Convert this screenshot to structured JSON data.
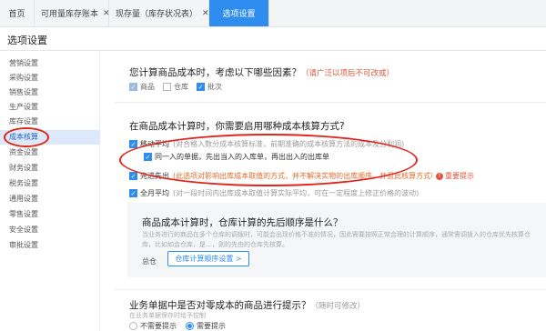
{
  "tabs": [
    {
      "label": "首页",
      "closable": false,
      "active": false
    },
    {
      "label": "可用量库存账本",
      "closable": true,
      "active": false
    },
    {
      "label": "现存量（库存状况表）",
      "closable": true,
      "active": false
    },
    {
      "label": "选项设置",
      "closable": false,
      "active": true
    }
  ],
  "page": {
    "title": "选项设置"
  },
  "sidebar": {
    "items": [
      "营销设置",
      "采购设置",
      "销售设置",
      "生产设置",
      "库存设置",
      "成本核算",
      "资金设置",
      "财务设置",
      "税务设置",
      "通用设置",
      "零售设置",
      "安全设置",
      "审批设置"
    ],
    "active_index": 5
  },
  "section1": {
    "question": "您计算商品成本时，考虑以下哪些因素？",
    "hint": "（请广泛以项后不可改或）",
    "factors": [
      {
        "label": "商品",
        "checked": true,
        "disabled": true
      },
      {
        "label": "仓库",
        "checked": false,
        "disabled": false
      },
      {
        "label": "批次",
        "checked": true,
        "disabled": false
      }
    ]
  },
  "section2": {
    "question": "在商品成本计算时，你需要启用哪种成本核算方式?",
    "options": [
      {
        "label": "移动平均",
        "note": "(对合格入数分成本核算标准，前期准确的成本核算方法的成本及分利润)",
        "checked": true
      },
      {
        "label": "同一入的单据，先出当入的入库单，再出出入的出库单",
        "note": "",
        "checked": true,
        "sub": true
      },
      {
        "label": "先进先出",
        "note": "(此选项对影响出库成本取值的方式，并不解决实物的出库顺序，并且此核算方式可能导致出入库作报全部采，请谨慎选择)",
        "warn": "重要提示",
        "checked": true
      },
      {
        "label": "全月平均",
        "note": "(对一段时间内出库成本取值计算实际平均，可在一定程度上修正价格的波动)",
        "checked": true
      }
    ]
  },
  "info": {
    "title": "商品成本计算时，仓库计算的先后顺序是什么？",
    "desc": "当业务进行的商品在多个仓库的调拨时，可能会出现价格不准的情况，因此需要按照正常合理的计算顺序，通常需调拨入的仓库优先核算仓库，比如如合仓库，是…，则的先由的仓库先核算。",
    "label": "总仓",
    "button": "仓库计算顺序设置 >"
  },
  "section3": {
    "question": "业务单据中是否对零成本的商品进行提示？",
    "hint": "（随时可修改）",
    "sub": "在业务单据保存时给予控制",
    "radios": [
      {
        "label": "不需要提示",
        "checked": false
      },
      {
        "label": "需要提示",
        "checked": true
      }
    ]
  }
}
